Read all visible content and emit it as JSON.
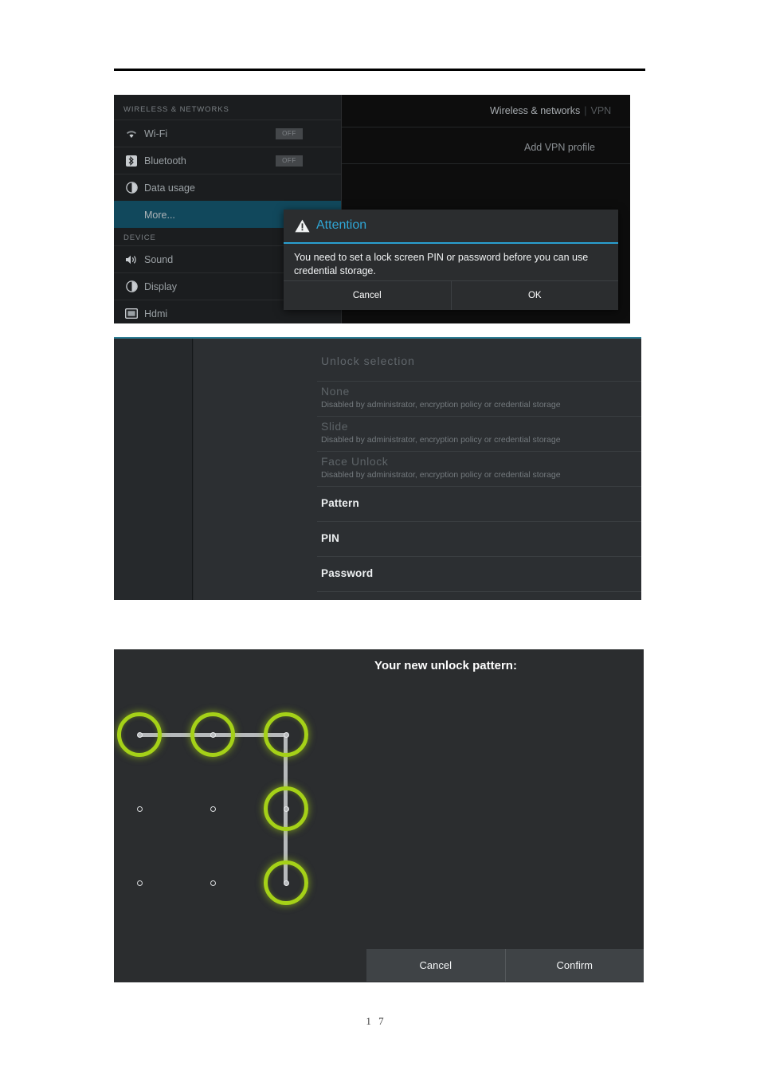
{
  "document": {
    "page_number": "1 7"
  },
  "panel_settings": {
    "sections": [
      {
        "heading": "WIRELESS & NETWORKS"
      },
      {
        "heading": "DEVICE"
      }
    ],
    "items": [
      {
        "label": "Wi-Fi",
        "icon": "wifi-icon",
        "toggle": "OFF",
        "selected": false
      },
      {
        "label": "Bluetooth",
        "icon": "bluetooth-icon",
        "toggle": "OFF",
        "selected": false
      },
      {
        "label": "Data usage",
        "icon": "data-usage-icon",
        "toggle": "",
        "selected": false
      },
      {
        "label": "More...",
        "icon": "",
        "toggle": "",
        "selected": true
      },
      {
        "label": "Sound",
        "icon": "sound-icon",
        "toggle": "",
        "selected": false
      },
      {
        "label": "Display",
        "icon": "display-icon",
        "toggle": "",
        "selected": false
      },
      {
        "label": "Hdmi",
        "icon": "hdmi-icon",
        "toggle": "",
        "selected": false
      }
    ],
    "breadcrumb": {
      "parent": "Wireless & networks",
      "separator": "|",
      "current": "VPN"
    },
    "add_vpn_profile": "Add VPN profile",
    "dialog": {
      "icon": "warning-triangle-icon",
      "title": "Attention",
      "message": "You need to set a lock screen PIN or password before you can use credential storage.",
      "buttons": [
        "Cancel",
        "OK"
      ],
      "accent_color": "#2a9fd0"
    }
  },
  "panel_unlock_selection": {
    "title": "Unlock selection",
    "options": [
      {
        "label": "None",
        "sub": "Disabled by administrator, encryption policy or credential storage",
        "enabled": false
      },
      {
        "label": "Slide",
        "sub": "Disabled by administrator, encryption policy or credential storage",
        "enabled": false
      },
      {
        "label": "Face Unlock",
        "sub": "Disabled by administrator, encryption policy or credential storage",
        "enabled": false
      },
      {
        "label": "Pattern",
        "sub": "",
        "enabled": true
      },
      {
        "label": "PIN",
        "sub": "",
        "enabled": true
      },
      {
        "label": "Password",
        "sub": "",
        "enabled": true
      }
    ]
  },
  "panel_pattern": {
    "title": "Your new unlock pattern:",
    "buttons": [
      "Cancel",
      "Confirm"
    ],
    "highlight_color": "#a5d118",
    "pattern_sequence": [
      0,
      1,
      2,
      5,
      8
    ],
    "grid_rows": 3,
    "grid_cols": 3
  }
}
